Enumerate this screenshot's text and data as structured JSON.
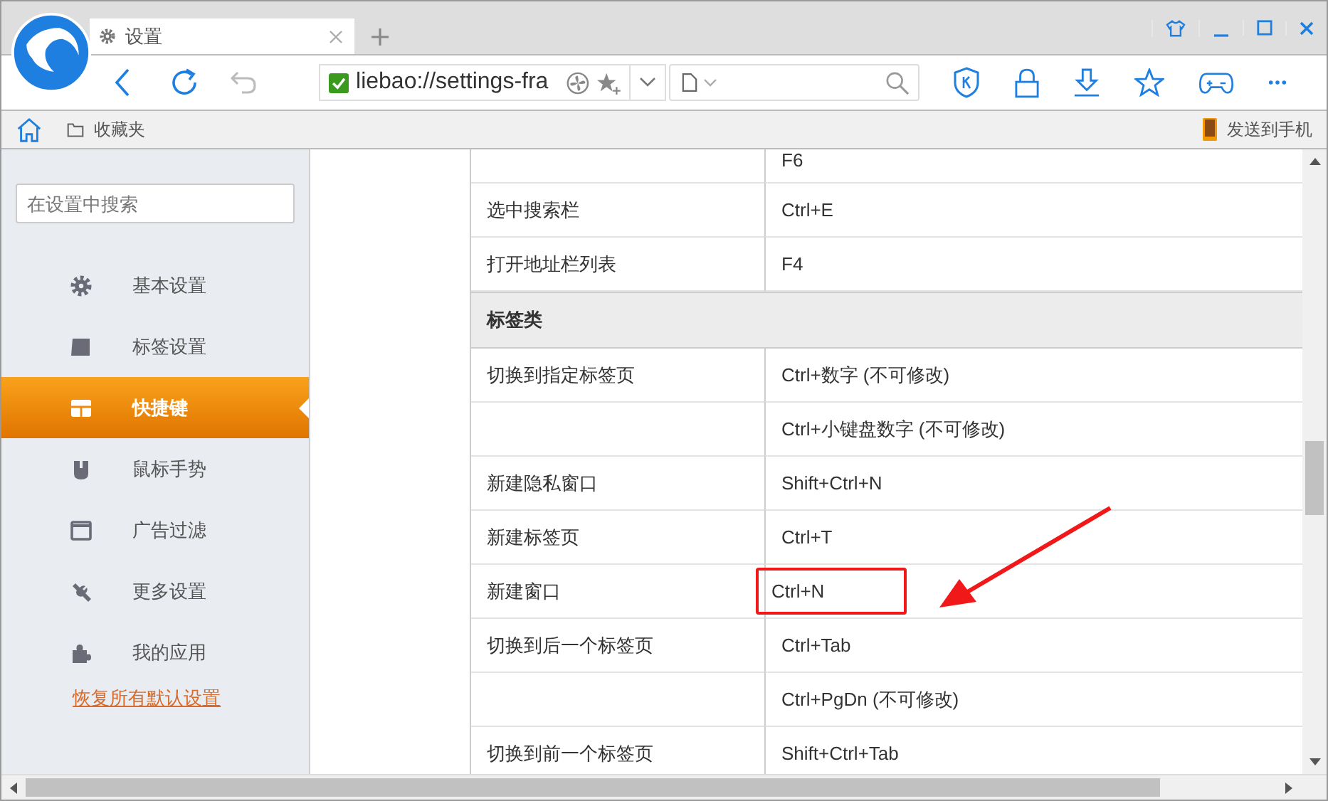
{
  "window": {
    "tab": {
      "title": "设置"
    }
  },
  "toolbar": {
    "nav_buttons": [
      {
        "disabled": false
      },
      {
        "disabled": false
      },
      {
        "disabled": true
      }
    ],
    "address": "liebao://settings-fra"
  },
  "bookmarks_bar": {
    "folder": "收藏夹",
    "send_to_phone": "发送到手机"
  },
  "sidebar": {
    "search": {
      "placeholder": "在设置中搜索"
    },
    "items": [
      {
        "label": "基本设置",
        "selected": false
      },
      {
        "label": "标签设置",
        "selected": false
      },
      {
        "label": "快捷键",
        "selected": true
      },
      {
        "label": "鼠标手势",
        "selected": false
      },
      {
        "label": "广告过滤",
        "selected": false
      },
      {
        "label": "更多设置",
        "selected": false
      },
      {
        "label": "我的应用",
        "selected": false
      }
    ],
    "reset_link": "恢复所有默认设置"
  },
  "shortcuts": {
    "rows": [
      {
        "kind": "row",
        "key": "F6",
        "highlighted": false
      },
      {
        "kind": "row",
        "action": "选中搜索栏",
        "key": "Ctrl+E",
        "highlighted": false
      },
      {
        "kind": "row",
        "action": "打开地址栏列表",
        "key": "F4",
        "highlighted": false
      },
      {
        "kind": "section",
        "title": "标签类"
      },
      {
        "kind": "row",
        "action": "切换到指定标签页",
        "key": "Ctrl+数字 (不可修改)",
        "highlighted": false
      },
      {
        "kind": "row",
        "key": "Ctrl+小键盘数字 (不可修改)",
        "highlighted": false
      },
      {
        "kind": "row",
        "action": "新建隐私窗口",
        "key": "Shift+Ctrl+N",
        "highlighted": false
      },
      {
        "kind": "row",
        "action": "新建标签页",
        "key": "Ctrl+T",
        "highlighted": false
      },
      {
        "kind": "row",
        "action": "新建窗口",
        "key": "Ctrl+N",
        "highlighted": true
      },
      {
        "kind": "row",
        "action": "切换到后一个标签页",
        "key": "Ctrl+Tab",
        "highlighted": false
      },
      {
        "kind": "row",
        "key": "Ctrl+PgDn (不可修改)",
        "highlighted": false
      },
      {
        "kind": "row",
        "action": "切换到前一个标签页",
        "key": "Shift+Ctrl+Tab",
        "highlighted": false
      }
    ]
  }
}
